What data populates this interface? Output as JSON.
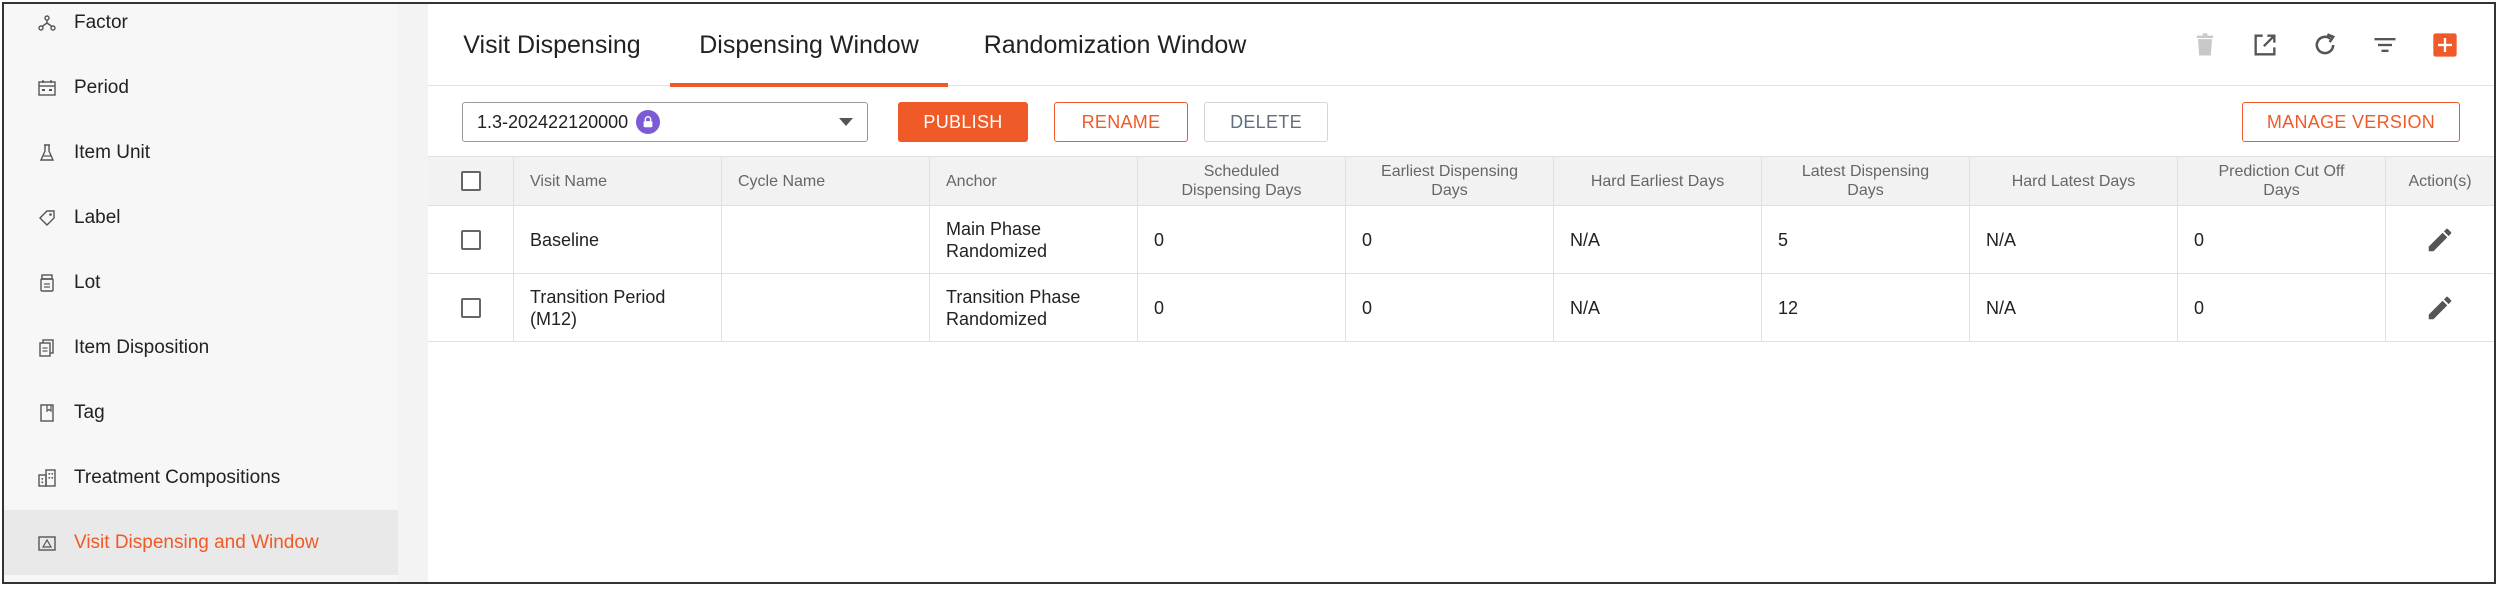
{
  "sidebar": {
    "items": [
      {
        "label": "Factor",
        "icon": "factor-icon"
      },
      {
        "label": "Period",
        "icon": "calendar-icon"
      },
      {
        "label": "Item Unit",
        "icon": "flask-icon"
      },
      {
        "label": "Label",
        "icon": "label-tag-icon"
      },
      {
        "label": "Lot",
        "icon": "lot-icon"
      },
      {
        "label": "Item Disposition",
        "icon": "disposition-icon"
      },
      {
        "label": "Tag",
        "icon": "bookmark-icon"
      },
      {
        "label": "Treatment Compositions",
        "icon": "building-icon"
      },
      {
        "label": "Visit Dispensing and Window",
        "icon": "dispensing-icon"
      }
    ],
    "active_index": 8
  },
  "tabs": [
    {
      "label": "Visit Dispensing"
    },
    {
      "label": "Dispensing Window"
    },
    {
      "label": "Randomization Window"
    }
  ],
  "active_tab_index": 1,
  "tools": [
    "delete-icon",
    "open-external-icon",
    "refresh-icon",
    "filter-icon",
    "add-icon"
  ],
  "toolbar": {
    "version_value": "1.3-202422120000",
    "publish_label": "PUBLISH",
    "rename_label": "RENAME",
    "delete_label": "DELETE",
    "manage_version_label": "MANAGE VERSION"
  },
  "table": {
    "columns": [
      "Visit Name",
      "Cycle Name",
      "Anchor",
      "Scheduled Dispensing Days",
      "Earliest Dispensing Days",
      "Hard Earliest Days",
      "Latest Dispensing Days",
      "Hard Latest Days",
      "Prediction Cut Off Days",
      "Action(s)"
    ],
    "rows": [
      {
        "visit_name": "Baseline",
        "cycle_name": "",
        "anchor": "Main Phase Randomized",
        "scheduled": "0",
        "earliest": "0",
        "hard_earliest": "N/A",
        "latest": "5",
        "hard_latest": "N/A",
        "cutoff": "0"
      },
      {
        "visit_name": "Transition Period (M12)",
        "cycle_name": "",
        "anchor": "Transition Phase Randomized",
        "scheduled": "0",
        "earliest": "0",
        "hard_earliest": "N/A",
        "latest": "12",
        "hard_latest": "N/A",
        "cutoff": "0"
      }
    ]
  },
  "colors": {
    "accent": "#f05a28",
    "lock": "#7b5cd6",
    "sidebar_bg": "#f7f7f7",
    "header_bg": "#f2f2f2"
  }
}
